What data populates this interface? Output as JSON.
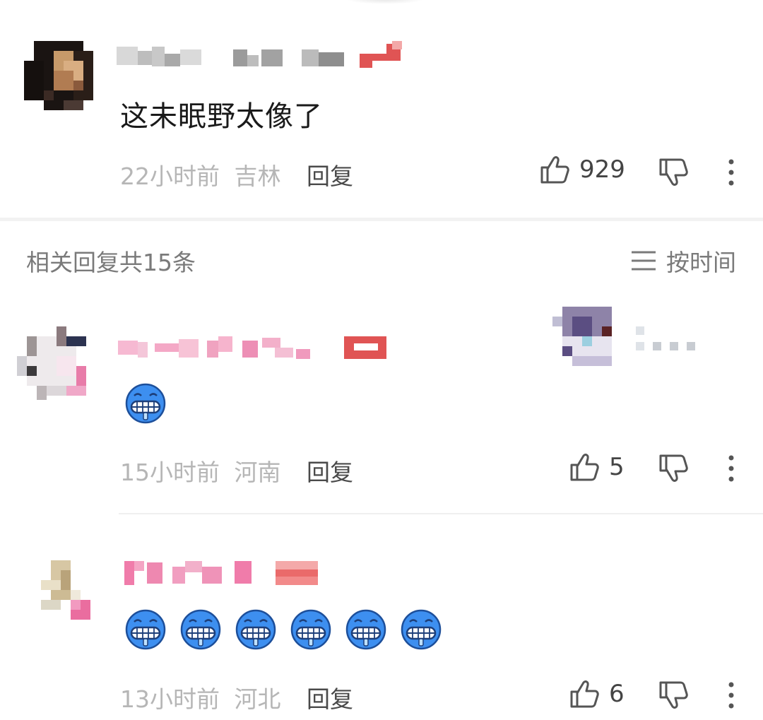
{
  "comment": {
    "text": "这未眠野太像了",
    "time": "22小时前",
    "location": "吉林",
    "reply_label": "回复",
    "likes": "929"
  },
  "replies_section": {
    "title": "相关回复共15条",
    "sort_label": "按时间"
  },
  "replies": [
    {
      "time": "15小时前",
      "location": "河南",
      "reply_label": "回复",
      "likes": "5",
      "emoji_count": 1
    },
    {
      "time": "13小时前",
      "location": "河北",
      "reply_label": "回复",
      "likes": "6",
      "emoji_count": 6
    }
  ],
  "icons": {
    "like": "thumbs-up-icon",
    "dislike": "thumbs-down-icon",
    "more": "more-vertical-icon",
    "sort": "sort-lines-icon",
    "emoji": "grimace-emoji-icon"
  },
  "colors": {
    "meta_gray": "#b6b6b6",
    "reply_dark": "#4a4a4a",
    "emoji_blue": "#3d8ff0"
  }
}
